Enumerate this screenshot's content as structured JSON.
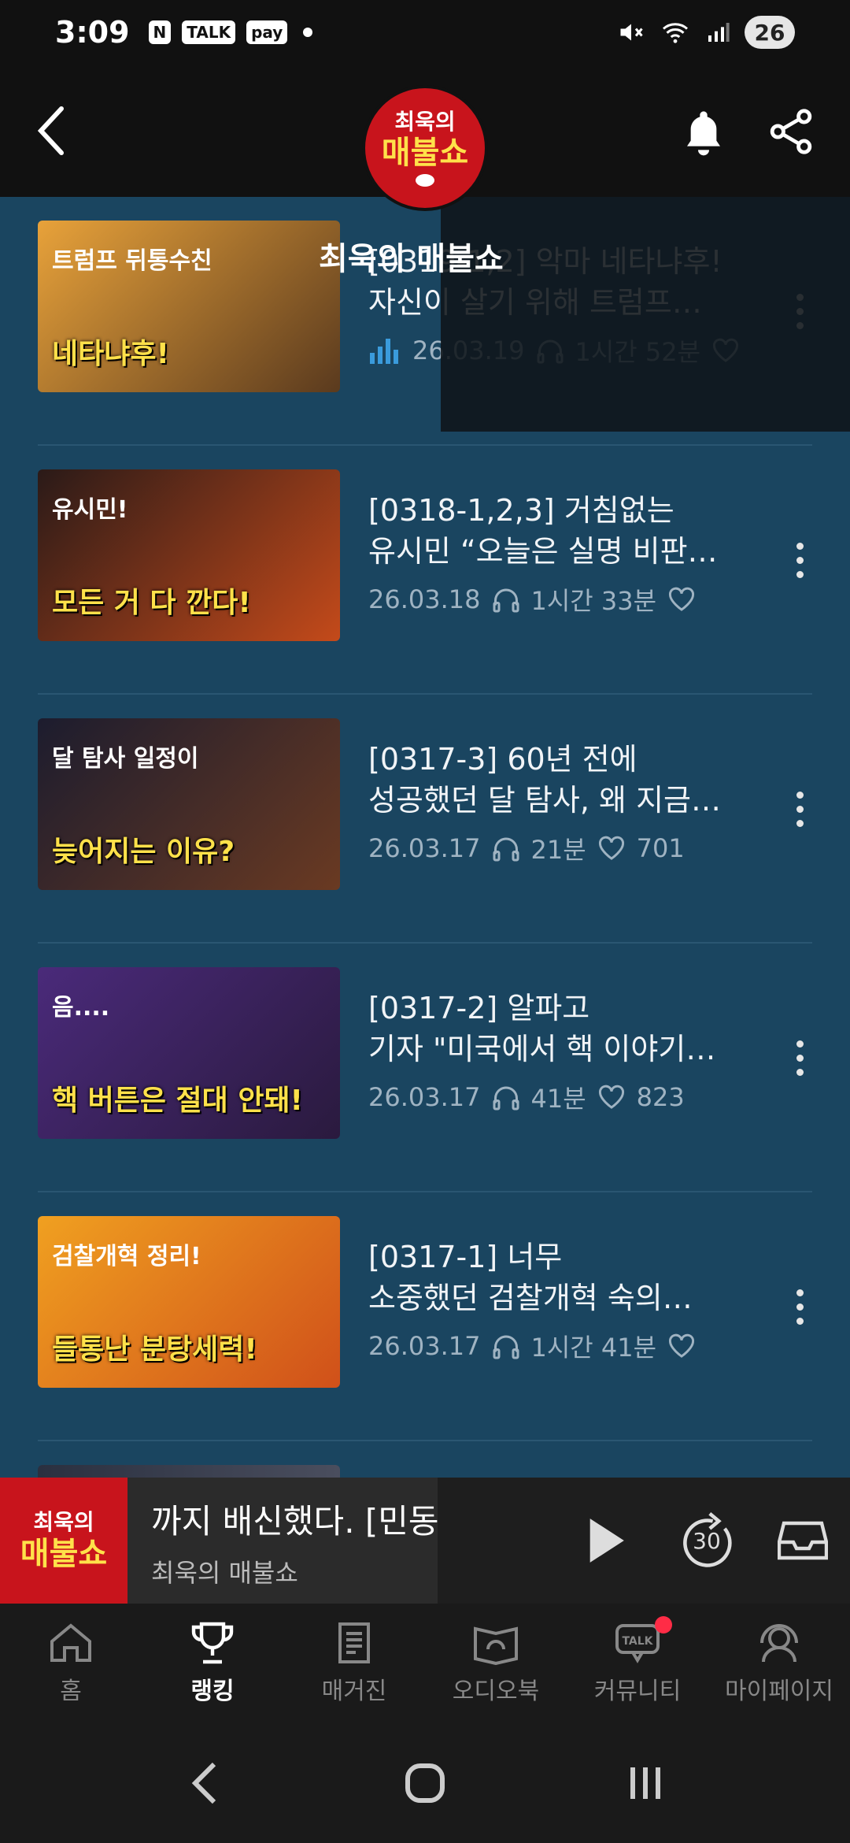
{
  "status_bar": {
    "time": "3:09",
    "chips": [
      "N",
      "TALK",
      "pay"
    ],
    "battery": "26"
  },
  "header": {
    "logo_small": "최욱의",
    "logo_big": "매불쇼",
    "scroll_title": "최욱의 매불쇼"
  },
  "episodes": [
    {
      "title_line1": "[0319-1,2] 악마 네타냐후!",
      "title_line2": "자신이 살기 위해 트럼프…",
      "date": "26.03.19",
      "duration": "1시간 52분",
      "likes": "",
      "playing": true,
      "thumb_text1": "트럼프 뒤통수친",
      "thumb_text2": "네타냐후!",
      "thumb_colors": [
        "#e8a23a",
        "#5a3a1e"
      ]
    },
    {
      "title_line1": "[0318-1,2,3] 거침없는",
      "title_line2": "유시민 “오늘은 실명 비판…",
      "date": "26.03.18",
      "duration": "1시간 33분",
      "likes": "",
      "playing": false,
      "thumb_text1": "유시민!",
      "thumb_text2": "모든 거 다 깐다!",
      "thumb_colors": [
        "#2a1a18",
        "#c44a1a"
      ]
    },
    {
      "title_line1": "[0317-3] 60년 전에",
      "title_line2": "성공했던 달 탐사, 왜 지금…",
      "date": "26.03.17",
      "duration": "21분",
      "likes": "701",
      "playing": false,
      "thumb_text1": "달 탐사 일정이",
      "thumb_text2": "늦어지는 이유?",
      "thumb_colors": [
        "#1c1c2e",
        "#6a3a22"
      ]
    },
    {
      "title_line1": "[0317-2] 알파고",
      "title_line2": "기자 \"미국에서 핵 이야기…",
      "date": "26.03.17",
      "duration": "41분",
      "likes": "823",
      "playing": false,
      "thumb_text1": "음....",
      "thumb_text2": "핵 버튼은 절대 안돼!",
      "thumb_colors": [
        "#4a2a7a",
        "#2a1a3e"
      ]
    },
    {
      "title_line1": "[0317-1] 너무",
      "title_line2": "소중했던 검찰개혁 숙의…",
      "date": "26.03.17",
      "duration": "1시간 41분",
      "likes": "",
      "playing": false,
      "thumb_text1": "검찰개혁 정리!",
      "thumb_text2": "들통난 분탕세력!",
      "thumb_colors": [
        "#f0a020",
        "#d0501a"
      ]
    }
  ],
  "mini_player": {
    "track": "까지 배신했다. [민동기,김",
    "artist": "최욱의 매불쇼",
    "logo_small": "최욱의",
    "logo_big": "매불쇼",
    "forward_seconds": "30"
  },
  "bottom_nav": {
    "items": [
      {
        "label": "홈",
        "icon": "home-icon"
      },
      {
        "label": "랭킹",
        "icon": "trophy-icon"
      },
      {
        "label": "매거진",
        "icon": "magazine-icon"
      },
      {
        "label": "오디오북",
        "icon": "audiobook-icon"
      },
      {
        "label": "커뮤니티",
        "icon": "talk-icon"
      },
      {
        "label": "마이페이지",
        "icon": "profile-icon"
      }
    ],
    "active_index": 1
  },
  "colors": {
    "list_background": "#1a4560",
    "logo_red": "#c8141c",
    "logo_yellow": "#ffe14a",
    "playing_blue": "#3a9bdc",
    "badge_red": "#ff2c46"
  }
}
